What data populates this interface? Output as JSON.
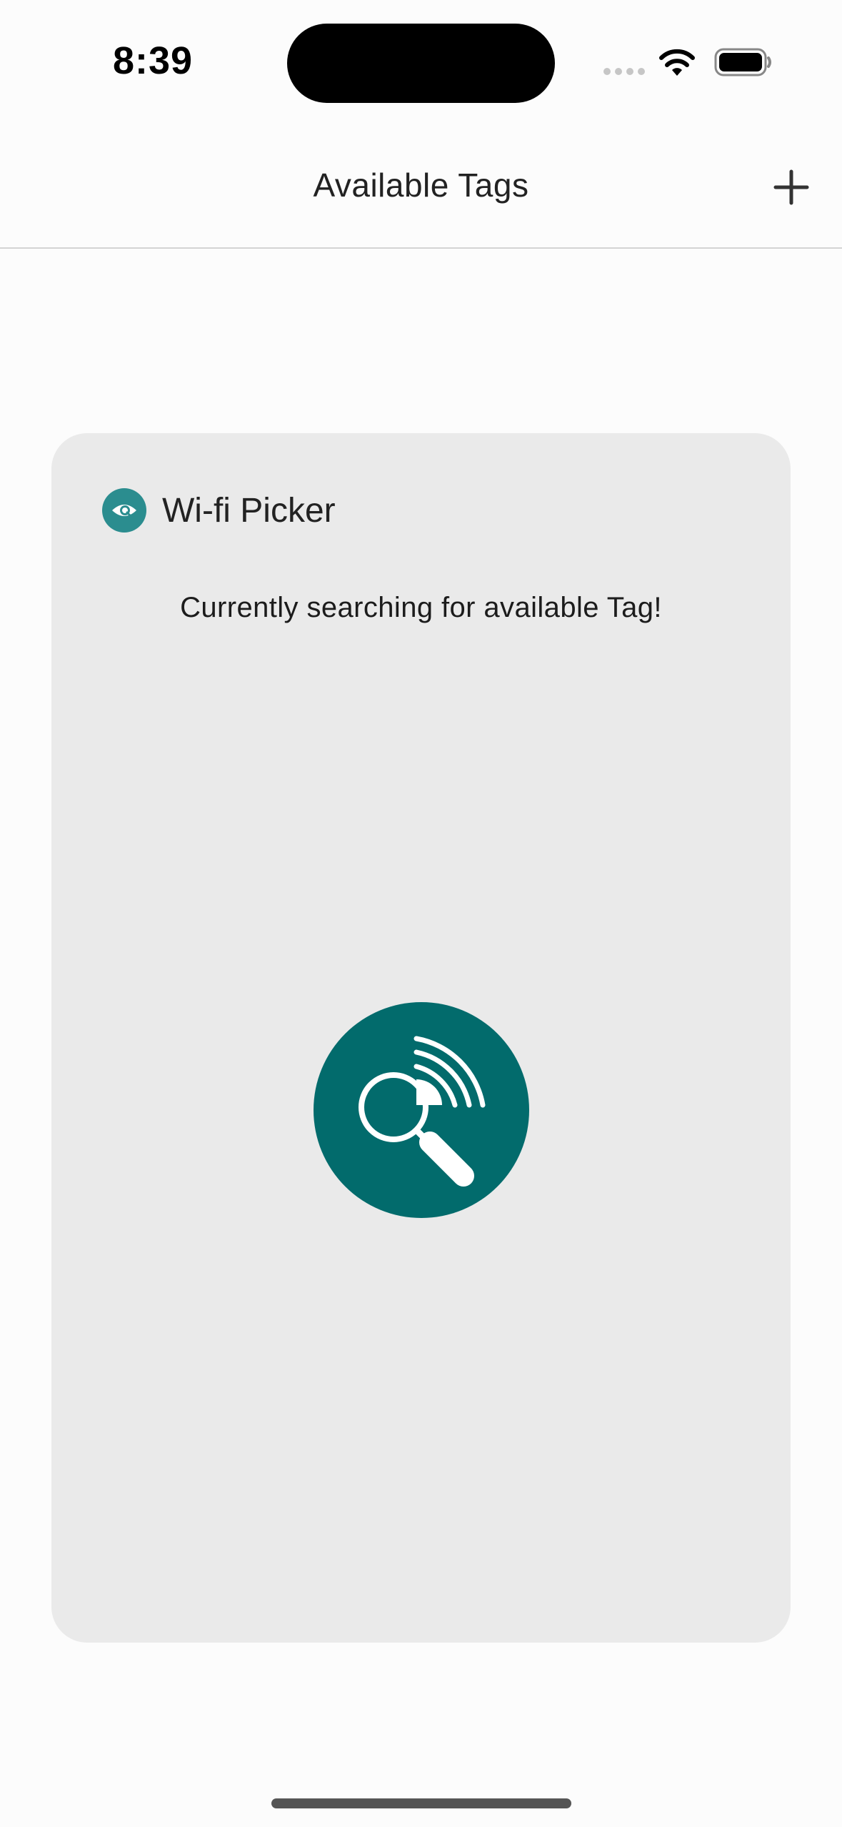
{
  "status_bar": {
    "time": "8:39"
  },
  "nav": {
    "title": "Available Tags",
    "add_label": "+"
  },
  "card": {
    "app_name": "Wi-fi Picker",
    "status_text": "Currently searching for available Tag!"
  },
  "colors": {
    "accent": "#026b6c",
    "logo": "#2b8d8f",
    "card_background": "#eaeaea",
    "page_background": "#fcfcfc"
  },
  "icons": {
    "wifi": "wifi-icon",
    "battery": "battery-icon",
    "add": "plus-icon",
    "logo": "eye-search-icon",
    "search": "magnifier-signal-icon"
  }
}
